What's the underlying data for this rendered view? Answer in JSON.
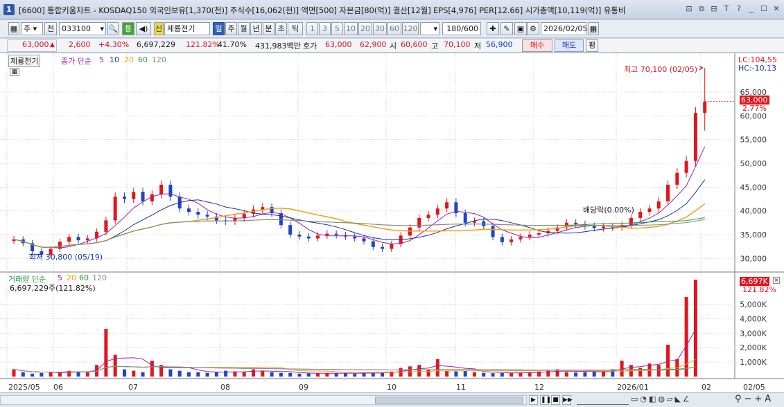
{
  "titlebar": {
    "window_no": "1",
    "title": "[6600] 통합키움차트 - KOSDAQ150 외국인보유[1,370(천)] 주식수[16,062(천)] 액면[500] 자본금[80(억)] 결산[12월] EPS[4,976] PER[12.66] 시가총액[10,119(억)] 유통비",
    "icons": [
      "⊡",
      "⧉",
      "⊟",
      "T",
      "?",
      "_",
      "☐",
      "✕"
    ]
  },
  "toolbar": {
    "period_type": "주",
    "prev_label": "전",
    "code": "033100",
    "tong_label": "통",
    "sin_label": "신",
    "name": "제룡전기",
    "periods": [
      "일",
      "주",
      "월",
      "년",
      "분",
      "초",
      "틱"
    ],
    "active_period": "일",
    "intervals": [
      "1",
      "3",
      "5",
      "10",
      "20",
      "30",
      "60",
      "120"
    ],
    "count": "180/600",
    "date": "2026/02/05"
  },
  "quote": {
    "price": "63,000",
    "change": "2,600",
    "change_pct": "+4.30%",
    "volume": "6,697,229",
    "vol_ratio": "121.82%",
    "turnover": "41.70%",
    "amount": "431,983백만",
    "bid_label": "호가",
    "ask": "63,000",
    "bid": "62,900",
    "open_label": "시",
    "open": "60,600",
    "high_label": "고",
    "high": "70,100",
    "low_label": "저",
    "low": "56,900",
    "buy_label": "매수",
    "sell_label": "매도",
    "avg_label": "평"
  },
  "chart": {
    "stock_tag": "제룡전기",
    "price_legend": [
      "종가 단순",
      "5",
      "10",
      "20",
      "60",
      "120"
    ],
    "volume_legend": [
      "거래량 단순",
      "5",
      "20",
      "60",
      "120"
    ],
    "volume_info": "6,697,229주(121.82%)",
    "lc": "LC:104,55",
    "hc": "HC:-10,13",
    "current_price_tag": "63,000",
    "current_pct_tag": "2.77%",
    "current_vol_tag": "6,697K",
    "current_vol_pct": "121.82%",
    "high_note": "최고 70,100 (02/05)",
    "low_note": "최저 30,800 (05/19)",
    "dividend_note": "배당락(0.00%)",
    "colors": {
      "up": "#e3141c",
      "down": "#1e44c8",
      "ma5": "#9b1fb5",
      "ma10": "#1b2f91",
      "ma20": "#f0a014",
      "ma60": "#2a9a3c",
      "ma120": "#8a8a8a"
    }
  },
  "chart_data": {
    "type": "candlestick",
    "title": "제룡전기",
    "price_axis": {
      "ticks": [
        30000,
        35000,
        40000,
        45000,
        50000,
        55000,
        60000,
        65000
      ],
      "tick_labels": [
        "30,000",
        "35,000",
        "40,000",
        "45,000",
        "50,000",
        "55,000",
        "60,000",
        "65,000"
      ],
      "ylim": [
        28000,
        72000
      ]
    },
    "volume_axis": {
      "ticks": [
        1000000,
        2000000,
        3000000,
        4000000,
        5000000
      ],
      "tick_labels": [
        "1,000K",
        "2,000K",
        "3,000K",
        "4,000K",
        "5,000K"
      ],
      "ylim": [
        0,
        6800000
      ]
    },
    "x_labels": [
      "2025/05",
      "06",
      "07",
      "08",
      "09",
      "10",
      "11",
      "12",
      "2026/01",
      "02",
      "02/05"
    ],
    "series": [
      {
        "name": "종가",
        "values": [
          34000,
          33200,
          31500,
          30800,
          32000,
          33500,
          34500,
          33800,
          34200,
          35600,
          38000,
          43000,
          42500,
          44000,
          42000,
          43500,
          45500,
          43000,
          40500,
          39800,
          39200,
          38800,
          38000,
          37800,
          38500,
          39400,
          40300,
          40800,
          39500,
          37000,
          35000,
          34600,
          34200,
          34800,
          35200,
          34900,
          34600,
          34200,
          33600,
          32400,
          32000,
          33000,
          34800,
          36500,
          38500,
          39200,
          40500,
          41800,
          39500,
          37500,
          37800,
          36800,
          34500,
          33400,
          34000,
          34500,
          35000,
          35300,
          35800,
          36500,
          37500,
          37200,
          36800,
          36400,
          36700,
          36500,
          37000,
          38500,
          39800,
          40500,
          42000,
          45500,
          48000,
          50500,
          60600,
          63000
        ]
      }
    ],
    "volume_values": [
      500000,
      300000,
      200000,
      250000,
      300000,
      280000,
      400000,
      350000,
      300000,
      800000,
      3300000,
      1500000,
      500000,
      400000,
      300000,
      1100000,
      800000,
      500000,
      400000,
      300000,
      300000,
      250000,
      300000,
      400000,
      350000,
      300000,
      500000,
      400000,
      300000,
      250000,
      250000,
      200000,
      220000,
      230000,
      240000,
      250000,
      230000,
      200000,
      250000,
      300000,
      280000,
      350000,
      600000,
      700000,
      800000,
      500000,
      1200000,
      400000,
      350000,
      400000,
      300000,
      250000,
      230000,
      240000,
      260000,
      280000,
      300000,
      350000,
      400000,
      500000,
      300000,
      280000,
      300000,
      350000,
      400000,
      500000,
      1100000,
      800000,
      600000,
      900000,
      800000,
      2200000,
      1200000,
      5500000,
      6697229
    ]
  }
}
